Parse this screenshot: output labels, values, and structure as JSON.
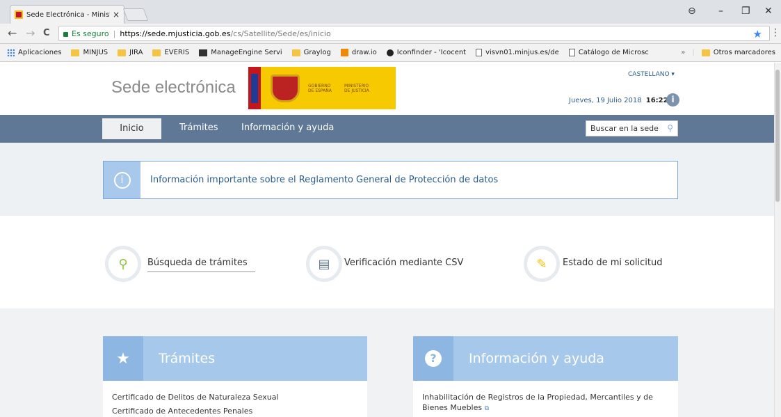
{
  "browser": {
    "tab_title": "Sede Electrónica - Minist",
    "close_glyph": "×",
    "window_controls": [
      "⊖",
      "–",
      "❐",
      "✕"
    ],
    "nav_back": "←",
    "nav_forward": "→",
    "nav_reload": "C",
    "secure_label": "Es seguro",
    "separator": "|",
    "url_host": "https://sede.mjusticia.gob.es",
    "url_path": "/cs/Satellite/Sede/es/inicio",
    "bookmark_star": "★",
    "menu_glyph": "⋮"
  },
  "bookmarks": {
    "items": [
      {
        "label": "Aplicaciones",
        "icon": "apps-icon"
      },
      {
        "label": "MINJUS",
        "icon": "folder-icon"
      },
      {
        "label": "JIRA",
        "icon": "folder-icon"
      },
      {
        "label": "EVERIS",
        "icon": "folder-icon"
      },
      {
        "label": "ManageEngine Servi",
        "icon": "manageengine-icon"
      },
      {
        "label": "Graylog",
        "icon": "folder-icon"
      },
      {
        "label": "draw.io",
        "icon": "drawio-icon"
      },
      {
        "label": "Iconfinder - 'Icocent",
        "icon": "iconfinder-icon"
      },
      {
        "label": "visvn01.minjus.es/de",
        "icon": "page-icon"
      },
      {
        "label": "Catálogo de Microsc",
        "icon": "page-icon"
      }
    ],
    "overflow": "»",
    "other": "Otros marcadores"
  },
  "header": {
    "title": "Sede electrónica",
    "logo_gobierno": "GOBIERNO DE ESPAÑA",
    "logo_ministerio": "MINISTERIO DE JUSTICIA",
    "language": "CASTELLANO ▾",
    "date": "Jueves, 19 Julio 2018",
    "time": "16:22 h.",
    "info_glyph": "i"
  },
  "nav": {
    "items": [
      "Inicio",
      "Trámites",
      "Información y ayuda"
    ],
    "search_placeholder": "Buscar en la sede",
    "search_glyph": "⚲"
  },
  "notice": {
    "glyph": "i",
    "text": "Información importante sobre el Reglamento General de Protección de datos"
  },
  "quick_actions": [
    {
      "label": "Búsqueda de trámites",
      "glyph": "⚲"
    },
    {
      "label": "Verificación mediante CSV",
      "glyph": "▤"
    },
    {
      "label": "Estado de mi solicitud",
      "glyph": "✎"
    }
  ],
  "cards": {
    "tramites": {
      "title": "Trámites",
      "glyph": "★",
      "links": [
        "Certificado de Delitos de Naturaleza Sexual",
        "Certificado de Antecedentes Penales"
      ]
    },
    "ayuda": {
      "title": "Información y ayuda",
      "glyph": "?",
      "links": [
        "Inhabilitación de Registros de la Propiedad, Mercantiles y de Bienes Muebles"
      ],
      "ext_glyph": "⧉"
    }
  },
  "colors": {
    "nav_bar": "#5f7896",
    "card_header": "#a6c8ea",
    "link_blue": "#2b5d8a",
    "logo_yellow": "#f6c900"
  }
}
